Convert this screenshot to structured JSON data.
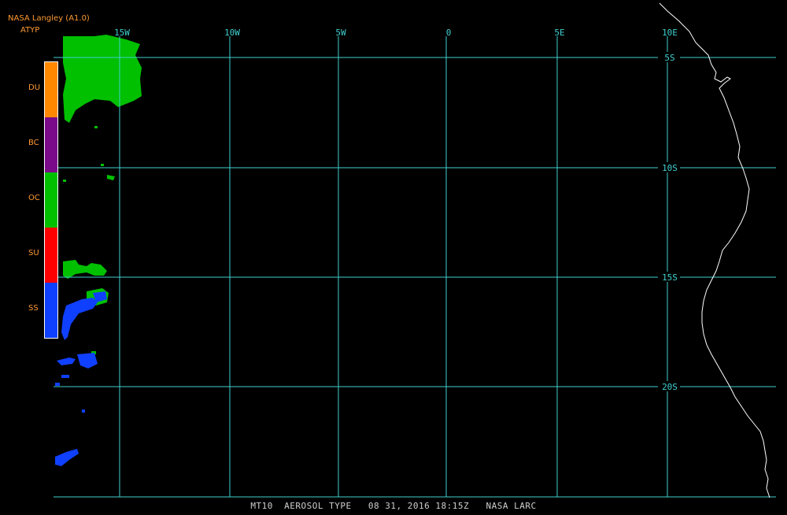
{
  "header": {
    "source": "NASA Langley (A1.0)",
    "product": "ATYP"
  },
  "legend": [
    {
      "code": "DU",
      "color": "#ff8800"
    },
    {
      "code": "BC",
      "color": "#7a0a8a"
    },
    {
      "code": "OC",
      "color": "#00c000"
    },
    {
      "code": "SU",
      "color": "#ff0000"
    },
    {
      "code": "SS",
      "color": "#1040ff"
    }
  ],
  "map": {
    "longitude_labels": [
      "15W",
      "10W",
      "5W",
      "0",
      "5E",
      "10E"
    ],
    "latitude_labels": [
      "5S",
      "10S",
      "15S",
      "20S"
    ],
    "grid_color": "#40d0d0",
    "coastline_color": "#ffffff",
    "background": "#000000"
  },
  "footer": {
    "caption": "MT10  AEROSOL TYPE   08 31, 2016 18:15Z   NASA LARC"
  }
}
